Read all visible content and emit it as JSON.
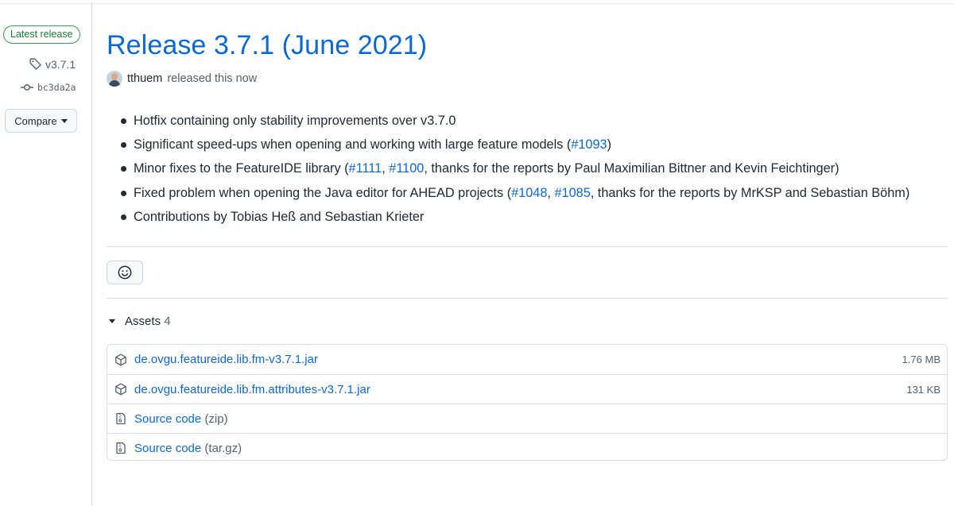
{
  "sidebar": {
    "latest_badge": "Latest release",
    "tag": "v3.7.1",
    "commit": "bc3da2a",
    "compare_label": "Compare"
  },
  "release": {
    "title": "Release 3.7.1 (June 2021)",
    "author": "tthuem",
    "released_text": "released this now",
    "notes": [
      {
        "text": "Hotfix containing only stability improvements over v3.7.0"
      },
      {
        "pre": "Significant speed-ups when opening and working with large feature models (",
        "link1": "#1093",
        "post": ")"
      },
      {
        "pre": "Minor fixes to the FeatureIDE library (",
        "link1": "#1111",
        "sep": ", ",
        "link2": "#1100",
        "post": ", thanks for the reports by Paul Maximilian Bittner and Kevin Feichtinger)"
      },
      {
        "pre": "Fixed problem when opening the Java editor for AHEAD projects (",
        "link1": "#1048",
        "sep": ", ",
        "link2": "#1085",
        "post": ", thanks for the reports by MrKSP and Sebastian Böhm)"
      },
      {
        "text": "Contributions by Tobias Heß and Sebastian Krieter"
      }
    ]
  },
  "assets": {
    "label": "Assets",
    "count": "4",
    "items": [
      {
        "name": "de.ovgu.featureide.lib.fm-v3.7.1.jar",
        "size": "1.76 MB",
        "icon": "package-icon"
      },
      {
        "name": "de.ovgu.featureide.lib.fm.attributes-v3.7.1.jar",
        "size": "131 KB",
        "icon": "package-icon"
      },
      {
        "name": "Source code",
        "suffix": "(zip)",
        "icon": "file-zip-icon"
      },
      {
        "name": "Source code",
        "suffix": "(tar.gz)",
        "icon": "file-zip-icon"
      }
    ]
  },
  "colors": {
    "link": "#0969da",
    "latest_badge": "#1a7f37",
    "text": "#24292f",
    "muted": "#57606a"
  }
}
